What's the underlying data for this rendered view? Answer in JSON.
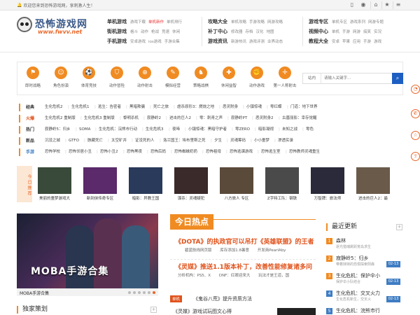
{
  "topbar": {
    "welcome": "欢迎您来到恐怖游戏网，享刺激人生！",
    "icons": [
      "mobile-icon",
      "weibo-icon",
      "home-icon",
      "star-icon",
      "menu-icon"
    ]
  },
  "logo": {
    "title": "恐怖游戏网",
    "domain": "www.fwvv.net"
  },
  "nav": [
    {
      "rows": [
        {
          "title": "单机游戏",
          "items": [
            "游戏下载",
            "单机新作",
            "单机排行"
          ],
          "hot": 1
        },
        {
          "title": "街机游戏",
          "items": [
            "格斗",
            "动作",
            "枪战",
            "竞速",
            "休闲"
          ]
        },
        {
          "title": "手机游戏",
          "items": [
            "安卓游戏",
            "ios游戏",
            "手游合集"
          ]
        }
      ]
    },
    {
      "rows": [
        {
          "title": "攻略大全",
          "items": [
            "单机攻略",
            "手游攻略",
            "网游攻略"
          ]
        },
        {
          "title": "补丁中心",
          "items": [
            "修改器",
            "存档",
            "汉化",
            "地图"
          ]
        },
        {
          "title": "游戏资讯",
          "items": [
            "新游热讯",
            "游戏评测",
            "业界动态"
          ]
        }
      ]
    },
    {
      "rows": [
        {
          "title": "游戏专区",
          "items": [
            "单机专区",
            "游戏系列",
            "网游专题"
          ]
        },
        {
          "title": "视频中心",
          "items": [
            "单机",
            "手游",
            "网游",
            "搞笑",
            "实况"
          ]
        },
        {
          "title": "教程大全",
          "items": [
            "安卓",
            "苹果",
            "应用",
            "手游",
            "游戏"
          ]
        }
      ]
    }
  ],
  "categories": [
    {
      "label": "即时战略",
      "icon": "strategy-icon",
      "glyph": "⚑"
    },
    {
      "label": "角色扮演",
      "icon": "mask-icon",
      "glyph": "☺"
    },
    {
      "label": "体育竞技",
      "icon": "soccer-ball-icon",
      "glyph": "⚽"
    },
    {
      "label": "动作冒险",
      "icon": "shield-icon",
      "glyph": "⛉"
    },
    {
      "label": "动作射击",
      "icon": "target-icon",
      "glyph": "⊕"
    },
    {
      "label": "模拟经营",
      "icon": "pencil-icon",
      "glyph": "✎"
    },
    {
      "label": "策略战棋",
      "icon": "chess-knight-icon",
      "glyph": "♞"
    },
    {
      "label": "休闲益智",
      "icon": "puzzle-icon",
      "glyph": "✚"
    },
    {
      "label": "动作游戏",
      "icon": "fist-icon",
      "glyph": "✊"
    },
    {
      "label": "第一人称射击",
      "icon": "crosshair-icon",
      "glyph": "✛"
    }
  ],
  "search": {
    "scope": "站内",
    "placeholder": "请输入关键字..."
  },
  "tagrows": [
    {
      "head": "经典",
      "color": "#333333",
      "tags": [
        "生化危机2",
        "生化危机1",
        "逃生：告密者",
        "黑暗欺骗",
        "死亡之旅",
        "虐杀原形3：燃烧之地",
        "恶灵附身",
        "小镇惊魂",
        "零红蝶",
        "门道：地下世界"
      ]
    },
    {
      "head": "火爆",
      "color": "#e0531c",
      "tags": [
        "生化危机2 重制版",
        "生化危机3 重制版",
        "黎明杀机",
        "寂静岭2",
        "进击的巨人2",
        "零：刺青之声",
        "寂静岭PT",
        "恶灵附身2",
        "古墓丽影：幸存觉醒"
      ]
    },
    {
      "head": "热门",
      "color": "#333333",
      "tags": [
        "寂静岭5：归乡",
        "SOMA",
        "生化危机：浣熊市行动",
        "生化危机3",
        "夜啼",
        "小镇惊魂：黑暗守护者",
        "零ZERO",
        "暗影凝视",
        "未知之战",
        "零色"
      ]
    },
    {
      "head": "新品",
      "color": "#333333",
      "tags": [
        "沉没之城",
        "GTFO",
        "骸藏死亡",
        "太空矿井",
        "证没死的人",
        "洛兰国王：埃布里斯之死",
        "夕生",
        "灵魂筹码",
        "小小噩梦",
        "渗透实录"
      ]
    },
    {
      "head": "手游",
      "color": "#3f7dc3",
      "tags": [
        "恐怖学校",
        "恐怖邻居小丑",
        "恐怖小丑2",
        "恐怖黑夜",
        "恐怖后妈",
        "恐怖蜘蛛奶奶",
        "恐怖祖母",
        "恐怖逃课游戏",
        "恐怖逃生室",
        "恐怖教师灵魂重生"
      ]
    }
  ],
  "games": {
    "tab": "今日推荐",
    "items": [
      "美丽的噩梦游戏大",
      "新到侠传奇专区",
      "暗影：异教王国",
      "谋杀：灵魂疑犯",
      "八方旅人 专区",
      "Z字特工队：钢铁",
      "万智牌：旅法师",
      "进击的巨人2：最"
    ]
  },
  "banner": {
    "title": "MOBA手游合集",
    "caption": "MOBA手游合集"
  },
  "hot": {
    "label": "今日热点",
    "news": [
      {
        "title": "《DOTA》的执政官可以吊打《英雄联盟》的王者",
        "subs": [
          "碧蓝航线网页版",
          "库存添加1.8暑意",
          "开发商PearlAby"
        ]
      },
      {
        "title": "《灵媒》推送1.1版本补丁，改善性能修复诸多问",
        "subs": [
          "分析机构：PS5、X",
          "DNF：红眼迎来大",
          "玩法才是王道，国"
        ]
      }
    ],
    "mini": [
      {
        "tag": "单机",
        "text": "《鬼谷八荒》提升资质方法"
      },
      {
        "tag": "",
        "text": "《灵媒》游戏试玩图文心得"
      }
    ]
  },
  "exclusive": {
    "title": "独家策划"
  },
  "updates": {
    "title": "最近更新",
    "items": [
      {
        "n": "1",
        "title": "森林",
        "sub": "逐光猎魂跳跃荒岛求生",
        "date": ""
      },
      {
        "n": "2",
        "title": "寂静岭5：归乡",
        "sub": "带着妹妹的恐惧探索阴森",
        "date": "02-13"
      },
      {
        "n": "3",
        "title": "生化危机：保护伞小",
        "sub": "保护伞小队结合",
        "date": "02-13"
      },
      {
        "n": "4",
        "title": "生化危机：交叉火力",
        "sub": "生化危机新生，交叉火",
        "date": "02-13"
      },
      {
        "n": "5",
        "title": "生化危机：浣熊市行",
        "sub": "",
        "date": ""
      }
    ]
  }
}
